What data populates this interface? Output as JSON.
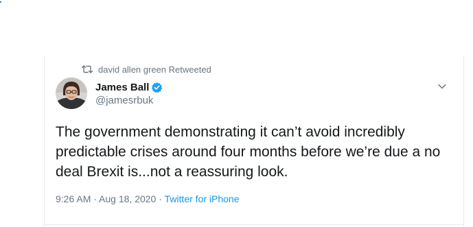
{
  "retweet": {
    "icon": "retweet-icon",
    "text": "david allen green Retweeted"
  },
  "author": {
    "name": "James Ball",
    "handle": "@jamesrbuk",
    "verified_icon": "verified-badge-icon",
    "verified_color": "#1da1f2",
    "avatar_icon": "avatar-photo"
  },
  "tweet": {
    "text": "The government demonstrating it can’t avoid incredibly predictable crises around four months before we’re due a no deal Brexit is...not a reassuring look."
  },
  "meta": {
    "time": "9:26 AM",
    "separator1": " · ",
    "date": "Aug 18, 2020",
    "separator2": " · ",
    "source": "Twitter for iPhone",
    "source_color": "#1b95e0"
  },
  "menu": {
    "icon": "chevron-down-icon"
  }
}
